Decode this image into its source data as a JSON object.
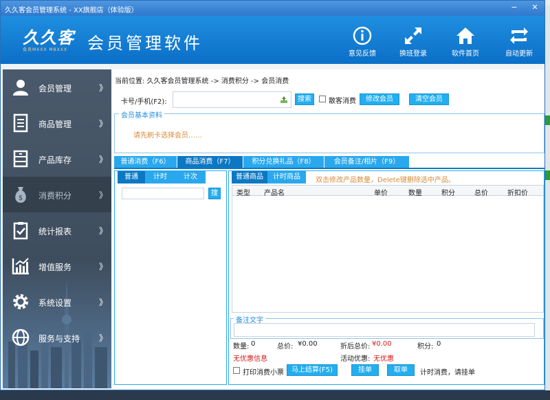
{
  "window": {
    "title": "久久客会员管理系统 - XX旗舰店（体验版）",
    "min_glyph": "−",
    "close_glyph": "✕"
  },
  "header": {
    "logo_text": "久久客",
    "logo_sub": "会员MXXX MBXXX",
    "app_name": "会员管理软件",
    "buttons": [
      {
        "label": "意见反馈",
        "icon": "info-icon"
      },
      {
        "label": "换班登录",
        "icon": "switch-user-icon"
      },
      {
        "label": "软件首页",
        "icon": "home-icon"
      },
      {
        "label": "自动更新",
        "icon": "refresh-icon"
      }
    ]
  },
  "sidebar": {
    "arrow": "》",
    "items": [
      {
        "label": "会员管理",
        "icon": "member-icon"
      },
      {
        "label": "商品管理",
        "icon": "document-icon"
      },
      {
        "label": "产品库存",
        "icon": "cabinet-icon"
      },
      {
        "label": "消费积分",
        "icon": "money-bag-icon",
        "active": true
      },
      {
        "label": "统计报表",
        "icon": "clipboard-check-icon"
      },
      {
        "label": "增值服务",
        "icon": "chart-icon"
      },
      {
        "label": "系统设置",
        "icon": "gear-icon"
      },
      {
        "label": "服务与支持",
        "icon": "globe-icon"
      }
    ]
  },
  "main": {
    "breadcrumb": "当前位置: 久久客会员管理系统 -> 消费积分 -> 会员消费",
    "card_label": "卡号/手机(F2):",
    "card_value": "",
    "search_btn": "搜索",
    "walkin_label": "散客消费",
    "edit_member_btn": "修改会员",
    "clear_member_btn": "清空会员",
    "member_info_legend": "会员基本资料",
    "member_info_hint": "请先刷卡选择会员……",
    "tabs": [
      "普通消费（F6）",
      "商品消费（F7）",
      "积分兑换礼品（F8）",
      "会员备注/相片（F9）"
    ],
    "left_subtabs": [
      "普通",
      "计时",
      "计次"
    ],
    "left_search_btn": "搜",
    "right_subtabs": [
      "普通商品",
      "计时商品"
    ],
    "right_hint": "双击修改产品数量，Delete键删除选中产品。",
    "table_headers": [
      "类型",
      "产品名",
      "单价",
      "数量",
      "积分",
      "总价",
      "折扣价"
    ],
    "note_legend": "备注文字",
    "summary": {
      "qty_label": "数量:",
      "qty_value": "0",
      "total_label": "总价: ",
      "total_value": "¥0.00",
      "discount_label": "折后总价: ",
      "discount_value": "¥0.00",
      "points_label": "积分: ",
      "points_value": "0",
      "no_discount": "无优惠信息",
      "promo_label": "活动优惠: ",
      "promo_value": "无优惠"
    },
    "print_label": "打印消费小票",
    "checkout_btn": "马上结算(F5)",
    "hang_btn": "挂单",
    "retrieve_btn": "取单",
    "timed_hint": "计时消费，请挂单"
  }
}
